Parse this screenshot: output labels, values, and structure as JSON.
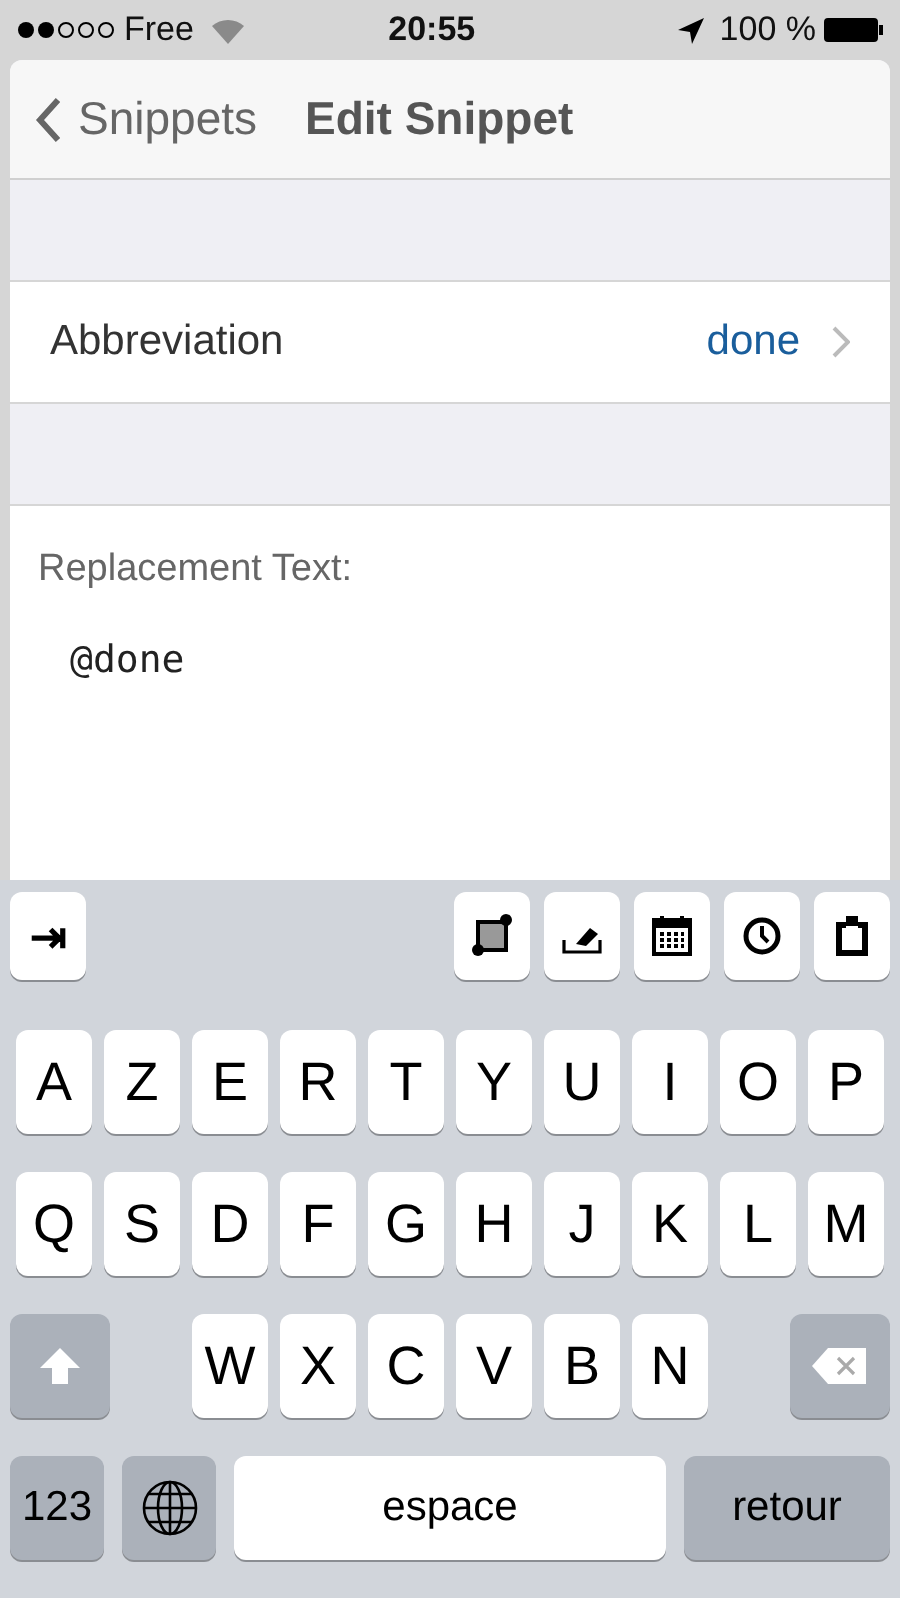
{
  "status_bar": {
    "carrier": "Free",
    "time": "20:55",
    "battery": "100 %"
  },
  "nav": {
    "back": "Snippets",
    "title": "Edit Snippet"
  },
  "abbreviation": {
    "label": "Abbreviation",
    "value": "done"
  },
  "replacement": {
    "label": "Replacement Text:",
    "value": "@done"
  },
  "keyboard": {
    "toolbar": [
      {
        "kind": "tab",
        "label": "⇥"
      },
      {
        "kind": "crop"
      },
      {
        "kind": "eraser"
      },
      {
        "kind": "calendar"
      },
      {
        "kind": "clock"
      },
      {
        "kind": "clipboard"
      }
    ],
    "top_row": [
      "A",
      "Z",
      "E",
      "R",
      "T",
      "Y",
      "U",
      "I",
      "O",
      "P"
    ],
    "middle_row": [
      "Q",
      "S",
      "D",
      "F",
      "G",
      "H",
      "J",
      "K",
      "L",
      "M"
    ],
    "bottom_row": [
      "W",
      "X",
      "C",
      "V",
      "B",
      "N"
    ],
    "numbers": "123",
    "space": "espace",
    "return": "retour"
  }
}
